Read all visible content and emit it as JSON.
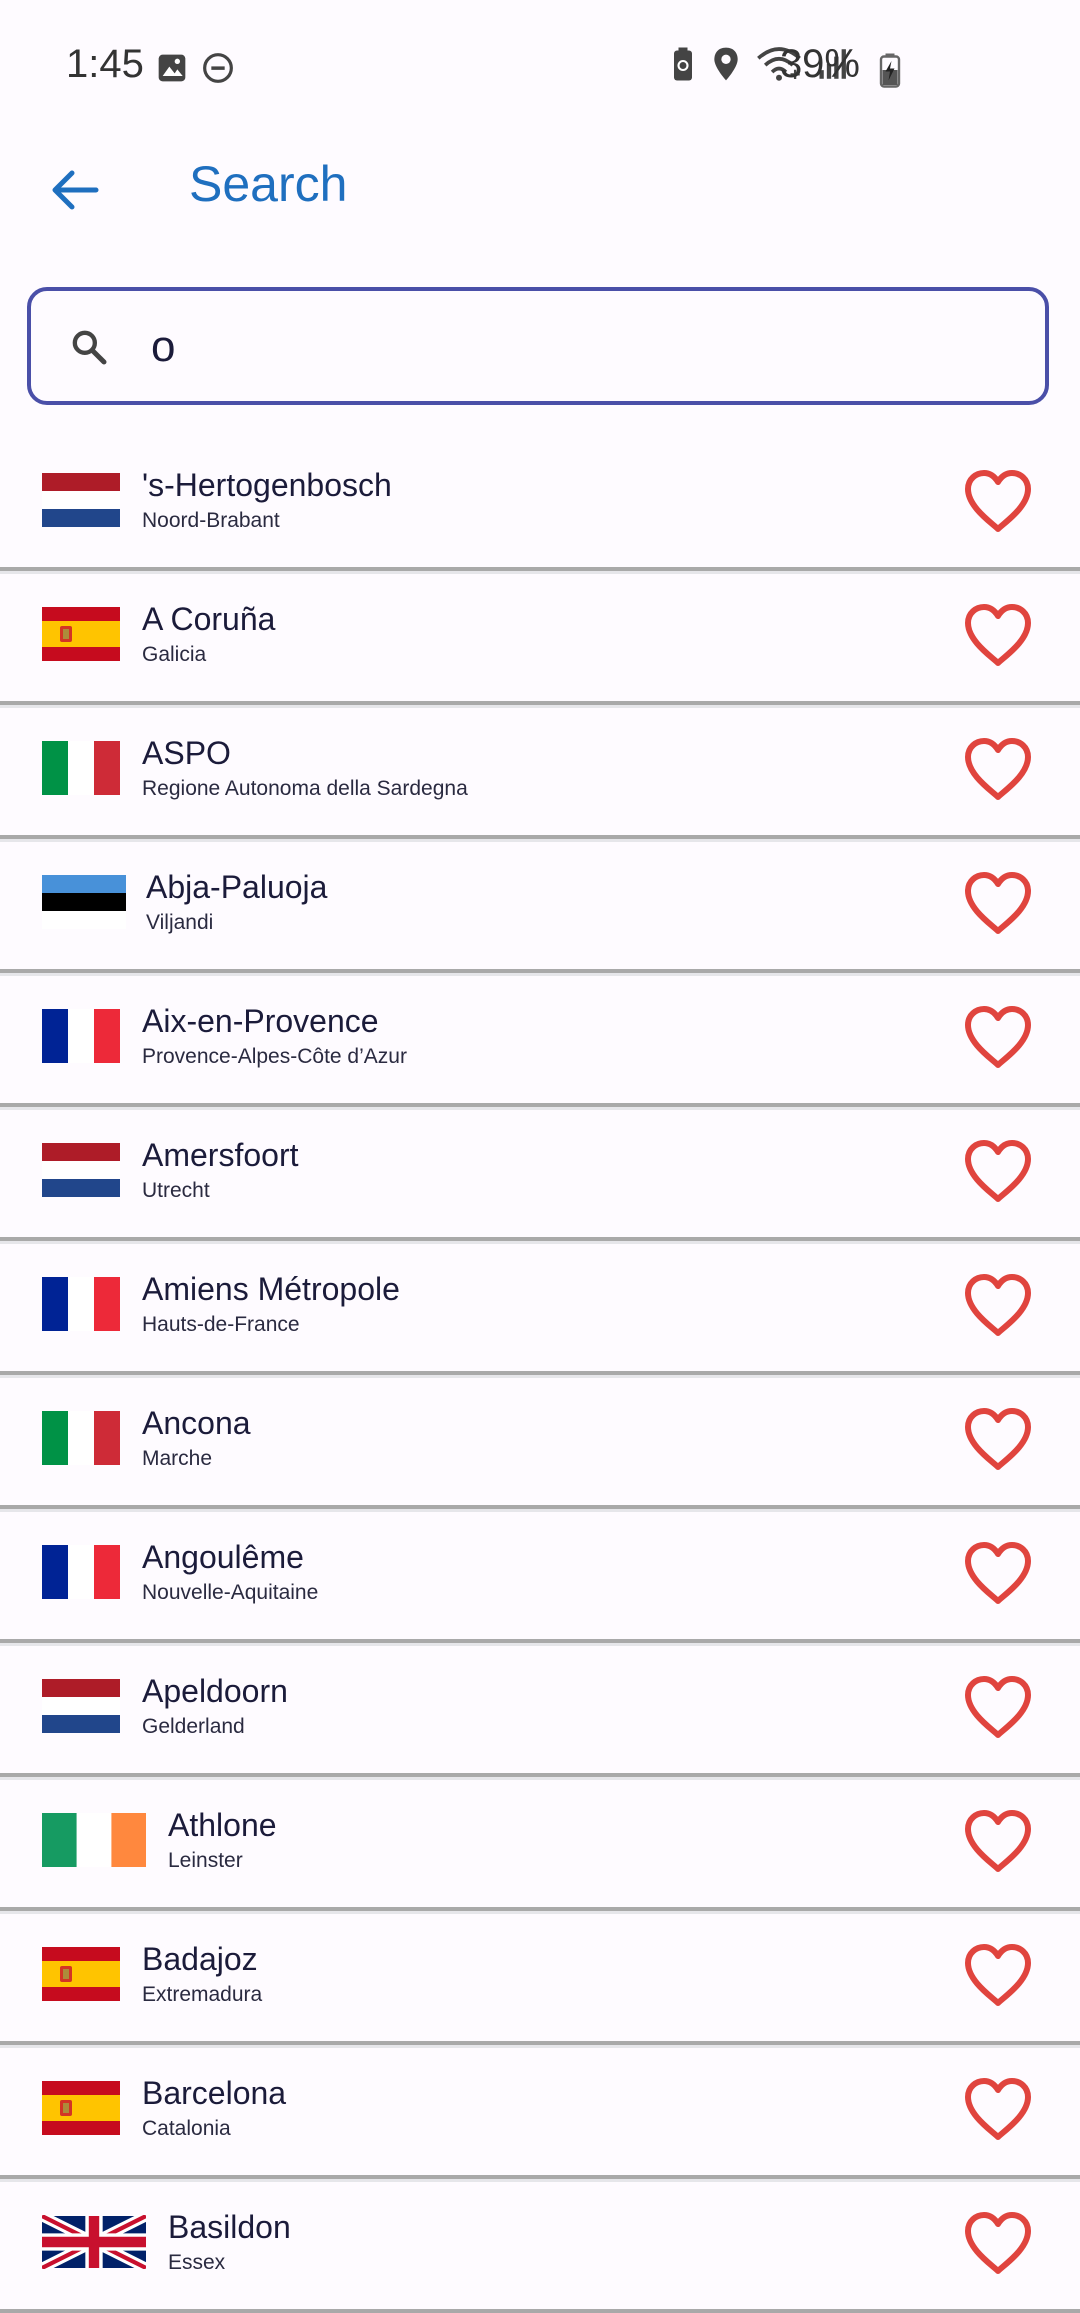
{
  "status_bar": {
    "time": "1:45",
    "battery": "39%",
    "icons": [
      "image-icon",
      "do-not-disturb-icon",
      "battery-saver-icon",
      "location-icon",
      "wifi-icon",
      "signal-icon",
      "battery-charging-icon"
    ]
  },
  "appbar": {
    "title": "Search",
    "back_icon": "arrow-back-icon"
  },
  "search": {
    "value": "o",
    "icon": "search-icon"
  },
  "colors": {
    "accent_blue": "#1f6fbf",
    "field_border": "#4a4fa8",
    "heart_red": "#e0443e"
  },
  "results": [
    {
      "city": "'s-Hertogenbosch",
      "region": "Noord-Brabant",
      "flag": "netherlands"
    },
    {
      "city": "A Coruña",
      "region": "Galicia",
      "flag": "spain"
    },
    {
      "city": "ASPO",
      "region": "Regione Autonoma della Sardegna",
      "flag": "italy"
    },
    {
      "city": "Abja-Paluoja",
      "region": "Viljandi",
      "flag": "estonia"
    },
    {
      "city": "Aix-en-Provence",
      "region": "Provence-Alpes-Côte d’Azur",
      "flag": "france"
    },
    {
      "city": "Amersfoort",
      "region": "Utrecht",
      "flag": "netherlands"
    },
    {
      "city": "Amiens Métropole",
      "region": "Hauts-de-France",
      "flag": "france"
    },
    {
      "city": "Ancona",
      "region": "Marche",
      "flag": "italy"
    },
    {
      "city": "Angoulême",
      "region": "Nouvelle-Aquitaine",
      "flag": "france"
    },
    {
      "city": "Apeldoorn",
      "region": "Gelderland",
      "flag": "netherlands"
    },
    {
      "city": "Athlone",
      "region": "Leinster",
      "flag": "ireland"
    },
    {
      "city": "Badajoz",
      "region": "Extremadura",
      "flag": "spain"
    },
    {
      "city": "Barcelona",
      "region": "Catalonia",
      "flag": "spain"
    },
    {
      "city": "Basildon",
      "region": "Essex",
      "flag": "uk"
    }
  ]
}
